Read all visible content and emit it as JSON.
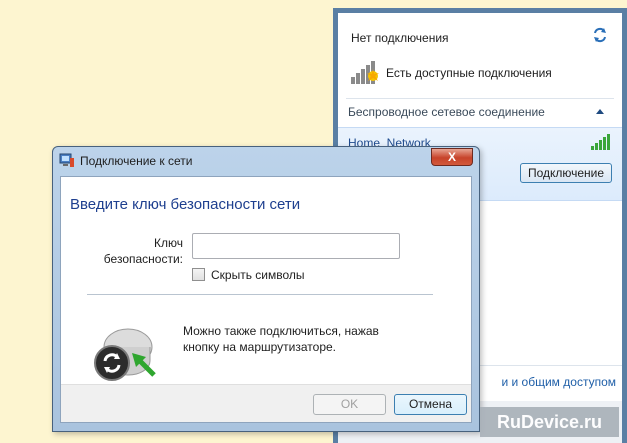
{
  "flyout": {
    "status": "Нет подключения",
    "available": "Есть доступные подключения",
    "section_title": "Беспроводное сетевое соединение",
    "network_name": "Home_Network",
    "connect_label": "Подключение",
    "footer_link": "и и общим доступом",
    "signal_color": "#3aa53a"
  },
  "dialog": {
    "title": "Подключение к сети",
    "close_glyph": "X",
    "heading": "Введите ключ безопасности сети",
    "key_label": "Ключ безопасности:",
    "key_value": "",
    "hide_chars_label": "Скрыть символы",
    "hide_chars_checked": false,
    "wps_text": "Можно также подключиться, нажав кнопку на маршрутизаторе.",
    "ok_label": "OK",
    "cancel_label": "Отмена",
    "accent_color": "#1e3f8f"
  },
  "watermark": {
    "text": "RuDevice.ru"
  }
}
